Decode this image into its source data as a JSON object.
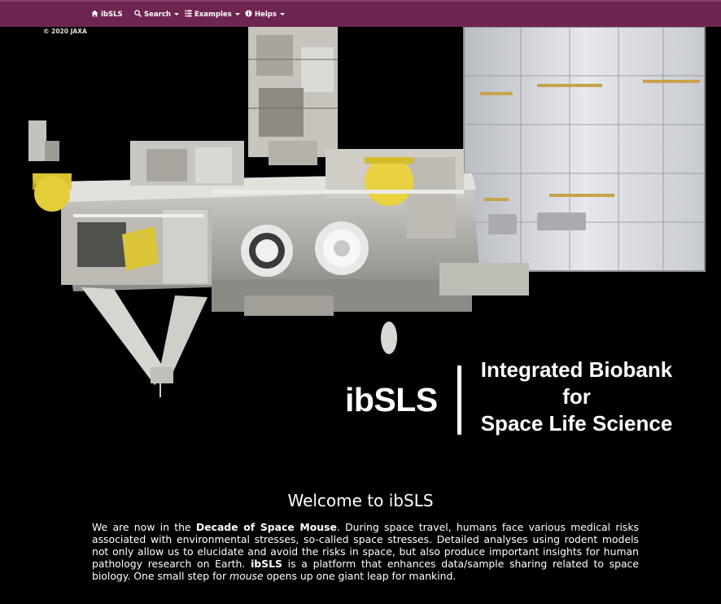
{
  "navbar": {
    "items": [
      {
        "label": "ibSLS",
        "icon": "home-icon",
        "dropdown": false
      },
      {
        "label": "Search",
        "icon": "search-icon",
        "dropdown": true
      },
      {
        "label": "Examples",
        "icon": "list-icon",
        "dropdown": true
      },
      {
        "label": "Helps",
        "icon": "info-icon",
        "dropdown": true
      }
    ],
    "background": "#6f2551"
  },
  "hero": {
    "copyright": "© 2020 JAXA",
    "logo_short": "ibSLS",
    "logo_full_line1": "Integrated Biobank",
    "logo_full_line2": "for",
    "logo_full_line3": "Space Life Science"
  },
  "welcome": {
    "title": "Welcome to ibSLS",
    "p1": "We are now in the ",
    "p1_bold": "Decade of Space Mouse",
    "p2": ". During space travel, humans face various medical risks associated with environmental stresses, so-called space stresses. Detailed analyses using rodent models not only allow us to elucidate and avoid the risks in space, but also produce important insights for human pathology research on Earth. ",
    "p2_bold": "ibSLS",
    "p3": " is a platform that enhances data/sample sharing related to space biology. One small step for ",
    "p3_italic": "mouse",
    "p4": " opens up one giant leap for mankind."
  }
}
